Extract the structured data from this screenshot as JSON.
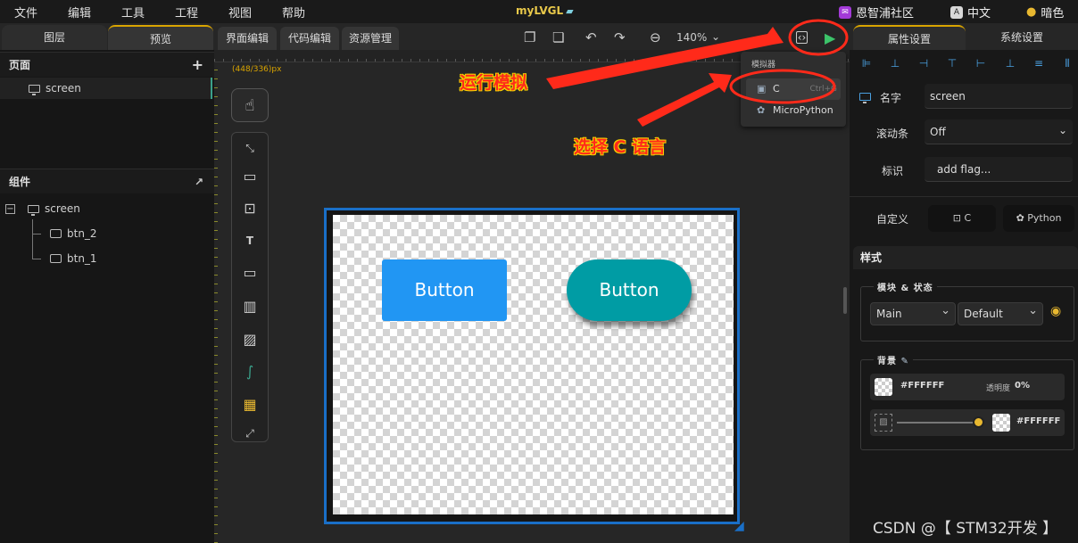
{
  "menu": [
    "文件",
    "编辑",
    "工具",
    "工程",
    "视图",
    "帮助"
  ],
  "app_title": "myLVGL",
  "top_right": {
    "community": "恩智浦社区",
    "language": "中文",
    "theme": "暗色"
  },
  "left_panel": {
    "tabs": [
      "图层",
      "预览"
    ],
    "pages_title": "页面",
    "pages": [
      "screen"
    ],
    "components_title": "组件",
    "tree": {
      "root": "screen",
      "children": [
        "btn_2",
        "btn_1"
      ]
    }
  },
  "editor": {
    "tabs": [
      "界面编辑",
      "代码编辑",
      "资源管理"
    ],
    "zoom": "140%",
    "canvas_size_label": "(448/336)px",
    "buttons": {
      "btn1_label": "Button",
      "btn2_label": "Button"
    }
  },
  "simulator_menu": {
    "title": "模拟器",
    "items": [
      {
        "label": "C",
        "shortcut": "Ctrl+G",
        "selected": true
      },
      {
        "label": "MicroPython",
        "shortcut": "",
        "selected": false
      }
    ]
  },
  "annotations": {
    "run_sim": "运行模拟",
    "select_c": "选择 C 语言"
  },
  "right_panel": {
    "tabs": [
      "属性设置",
      "系统设置"
    ],
    "props": [
      {
        "label": "名字",
        "value": "screen"
      },
      {
        "label": "滚动条",
        "value": "Off"
      },
      {
        "label": "标识",
        "value": "add flag..."
      }
    ],
    "custom_label": "自定义",
    "custom_buttons": [
      "C",
      "Python"
    ],
    "style_title": "样式",
    "part_state_title": "模块 & 状态",
    "part_select": "Main",
    "state_select": "Default",
    "bg_title": "背景",
    "bg_color": "#FFFFFF",
    "opacity_label": "透明度",
    "opacity_value": "0%",
    "grad_color": "#FFFFFF"
  },
  "watermark": "CSDN @【 STM32开发 】",
  "colors": {
    "accent": "#d9a400",
    "selection": "#1a6fc7",
    "btn1": "#2196f3",
    "btn2": "#009ca4",
    "annotation": "#ff2a1a"
  }
}
